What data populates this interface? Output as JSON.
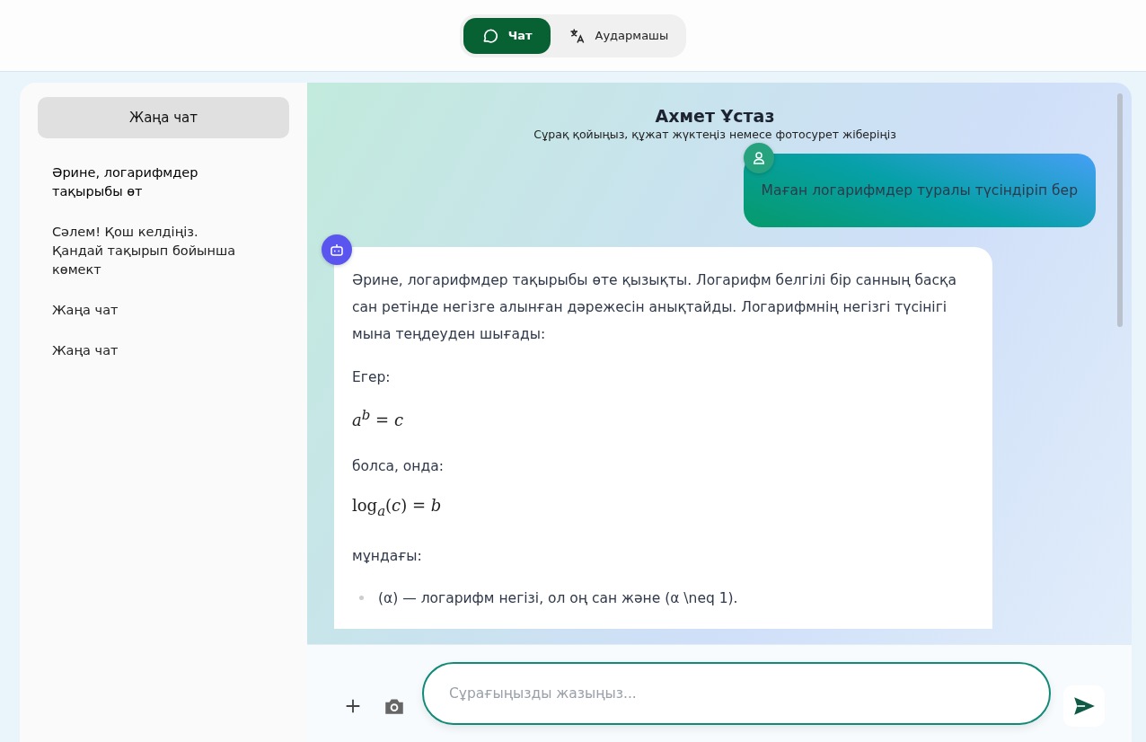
{
  "top_tabs": [
    {
      "label": "Чат",
      "kind": "chat",
      "selected": true
    },
    {
      "label": "Аудармашы",
      "kind": "translate",
      "selected": false
    }
  ],
  "sidebar": {
    "new_chat_button": "Жаңа чат",
    "items": [
      {
        "title": "Әрине, логарифмдер тақырыбы өт",
        "selected": true
      },
      {
        "title": "Сәлем! Қош келдіңіз. Қандай тақырып бойынша көмект",
        "selected": false
      },
      {
        "title": "Жаңа чат",
        "selected": false
      },
      {
        "title": "Жаңа чат",
        "selected": false
      }
    ]
  },
  "chat": {
    "title": "Ахмет Ұстаз",
    "subtitle": "Сұрақ қойыңыз, құжат жүктеңіз немесе фотосурет жіберіңіз",
    "messages": [
      {
        "kind": "user",
        "blocks": [
          {
            "kind": "text",
            "text": "Маған логарифмдер туралы түсіндіріп бер"
          }
        ]
      },
      {
        "kind": "bot",
        "blocks": [
          {
            "kind": "text",
            "text": "Әрине, логарифмдер тақырыбы өте қызықты. Логарифм белгілі бір санның басқа сан ретінде негізге алынған дәрежесін анықтайды. Логарифмнің негізгі түсінігі мына теңдеуден шығады:"
          },
          {
            "kind": "text",
            "text": "Егер:"
          },
          {
            "kind": "math",
            "text": "*a*$^{b}$ = *c*"
          },
          {
            "kind": "text",
            "text": "болса, онда:"
          },
          {
            "kind": "math",
            "text": "log$_{a}$(*c*) = *b*"
          },
          {
            "kind": "text",
            "text": "мұндағы:"
          },
          {
            "kind": "bullet",
            "text": "(α) — логарифм негізі, ол оң сан және (α \\neq 1)."
          }
        ]
      }
    ]
  },
  "composer": {
    "placeholder": "Сұрағыңызды жазыңыз..."
  }
}
